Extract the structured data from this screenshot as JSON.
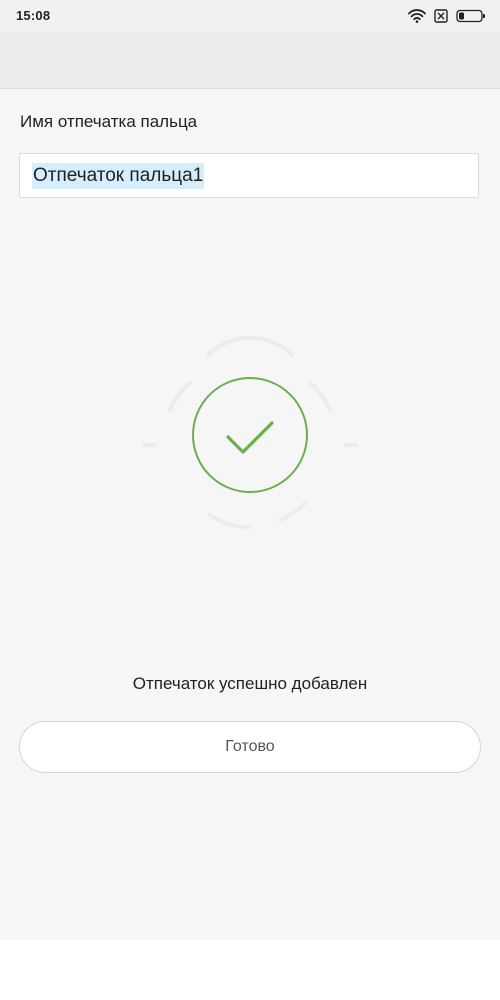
{
  "status_bar": {
    "time": "15:08",
    "icons": [
      "wifi-icon",
      "sim-none-icon",
      "battery-icon"
    ]
  },
  "fingerprint_form": {
    "name_label": "Имя отпечатка пальца",
    "name_value": "Отпечаток пальца1"
  },
  "result": {
    "success_message": "Отпечаток успешно добавлен",
    "done_label": "Готово",
    "icon": "check-icon"
  },
  "colors": {
    "background": "#f6f6f6",
    "success": "#6ab04c",
    "selection": "#d5eefb"
  }
}
